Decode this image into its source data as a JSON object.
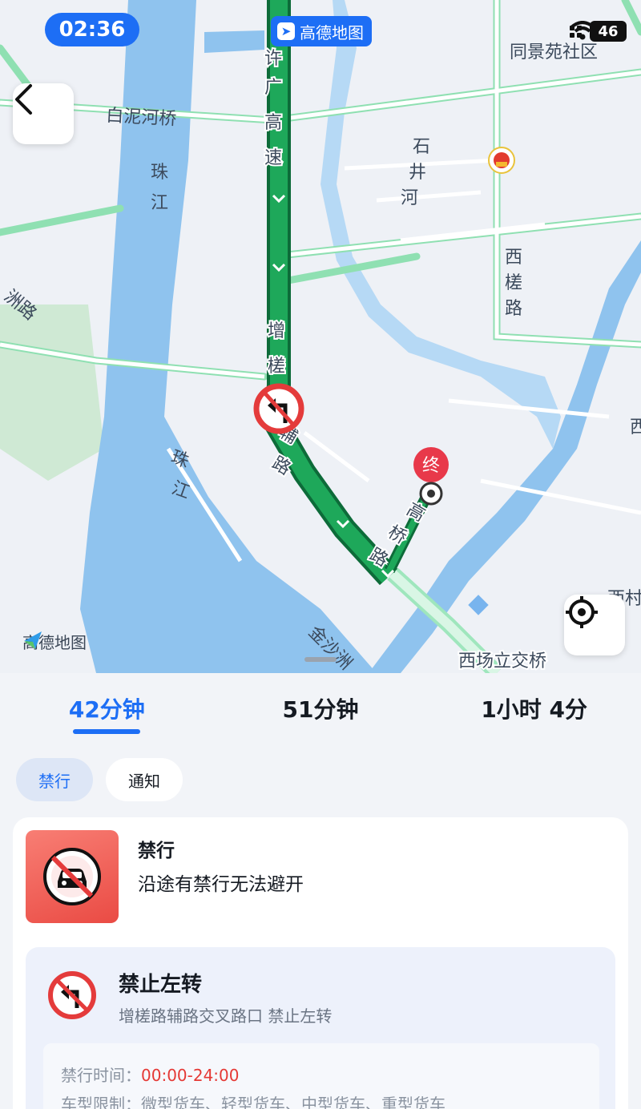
{
  "status_bar": {
    "time": "02:36",
    "app_name": "高德地图",
    "battery": "46"
  },
  "map": {
    "labels": {
      "xuguang_highway": "许广高速",
      "bainihe_bridge": "白泥河桥",
      "zhujiang_1": "珠江",
      "zhujiang_2": "珠江",
      "shijing_river": "石井河",
      "xilou_road": "西槎路",
      "zengcha_road": "增槎",
      "zengcha_aux": "辅路",
      "gaoqiao_road": "高桥路",
      "tongjingyuan": "同景苑社区",
      "zhouzhou_road": "洲路",
      "xichang_interchange": "西场立交桥",
      "jinshajiang": "金沙洲",
      "xi_partial": "西",
      "xi_right": "西村"
    },
    "destination_marker": "终",
    "watermark": "高德地图"
  },
  "route_tabs": [
    {
      "label": "42分钟",
      "active": true
    },
    {
      "label": "51分钟",
      "active": false
    },
    {
      "label": "1小时 4分",
      "active": false
    }
  ],
  "filters": [
    {
      "label": "禁行",
      "active": true
    },
    {
      "label": "通知",
      "active": false
    }
  ],
  "restriction": {
    "title": "禁行",
    "description": "沿途有禁行无法避开",
    "item": {
      "title": "禁止左转",
      "location": "增槎路辅路交叉路口 禁止左转",
      "time_label": "禁行时间：",
      "time_value": "00:00-24:00",
      "vehicle_label": "车型限制：",
      "vehicle_value": "微型货车、轻型货车、中型货车、重型货车"
    }
  },
  "colors": {
    "accent": "#1d6ef5",
    "route": "#1ea85a",
    "warning": "#e53935"
  }
}
